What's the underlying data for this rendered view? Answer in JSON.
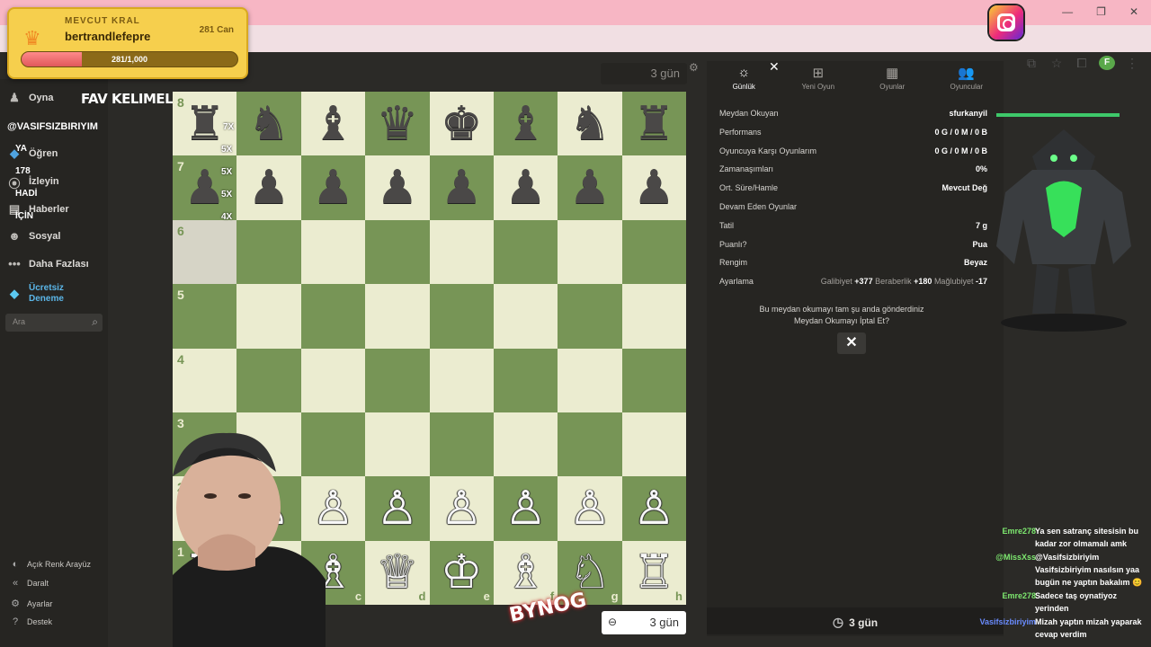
{
  "king": {
    "subtitle": "MEVCUT KRAL",
    "username": "bertrandlefepre",
    "coins": "281 Can",
    "progress_text": "281/1,000",
    "progress_fraction": 0.281
  },
  "sidebar": {
    "items": [
      {
        "label": "Oyna",
        "icon": "pawn-icon"
      },
      {
        "label": "Öğren",
        "icon": "learn-icon"
      },
      {
        "label": "İzleyin",
        "icon": "binoculars-icon"
      },
      {
        "label": "Haberler",
        "icon": "news-icon"
      },
      {
        "label": "Sosyal",
        "icon": "social-icon"
      },
      {
        "label": "Daha Fazlası",
        "icon": "more-icon"
      },
      {
        "label": "Ücretsiz Deneme",
        "icon": "diamond-icon"
      }
    ],
    "search_placeholder": "Ara",
    "bottom": [
      {
        "label": "Açık Renk Arayüz",
        "icon": "theme-icon"
      },
      {
        "label": "Daralt",
        "icon": "collapse-icon"
      },
      {
        "label": "Ayarlar",
        "icon": "gear-icon"
      },
      {
        "label": "Destek",
        "icon": "help-icon"
      }
    ],
    "overlay": {
      "fav": "FAV KELIMELER",
      "vasif": "@VASIFSIZBIRIYIM",
      "ya": "YA",
      "num": "178",
      "hadi": "HADİ",
      "icin": "İÇİN"
    }
  },
  "board": {
    "top_timer": "3 gün",
    "bottom_timer": "3 gün",
    "ranks": [
      "8",
      "7",
      "6",
      "5",
      "4",
      "3",
      "2",
      "1"
    ],
    "files": [
      "a",
      "b",
      "c",
      "d",
      "e",
      "f",
      "g",
      "h"
    ],
    "rows": [
      [
        "♜",
        "♞",
        "♝",
        "♛",
        "♚",
        "♝",
        "♞",
        "♜"
      ],
      [
        "♟",
        "♟",
        "♟",
        "♟",
        "♟",
        "♟",
        "♟",
        "♟"
      ],
      [
        "",
        "",
        "",
        "",
        "",
        "",
        "",
        ""
      ],
      [
        "",
        "",
        "",
        "",
        "",
        "",
        "",
        ""
      ],
      [
        "",
        "",
        "",
        "",
        "",
        "",
        "",
        ""
      ],
      [
        "",
        "",
        "",
        "",
        "",
        "",
        "",
        ""
      ],
      [
        "♙",
        "♙",
        "♙",
        "♙",
        "♙",
        "♙",
        "♙",
        "♙"
      ],
      [
        "♖",
        "♘",
        "♗",
        "♕",
        "♔",
        "♗",
        "♘",
        "♖"
      ]
    ],
    "multipliers": [
      "7X",
      "5X",
      "5X",
      "4X",
      "5X"
    ],
    "sticker": "BYNOG"
  },
  "panel": {
    "tabs": [
      {
        "label": "Günlük",
        "icon": "sun-icon",
        "active": true
      },
      {
        "label": "Yeni Oyun",
        "icon": "plus-icon",
        "active": false
      },
      {
        "label": "Oyunlar",
        "icon": "board-icon",
        "active": false
      },
      {
        "label": "Oyuncular",
        "icon": "players-icon",
        "active": false
      }
    ],
    "rows": [
      {
        "label": "Meydan Okuyan",
        "value": "sfurkanyil"
      },
      {
        "label": "Performans",
        "value": "0 G / 0 M / 0 B"
      },
      {
        "label": "Oyuncuya Karşı Oyunlarım",
        "value": "0 G / 0 M / 0 B"
      },
      {
        "label": "Zamanaşımları",
        "value": "0%"
      },
      {
        "label": "Ort. Süre/Hamle",
        "value": "Mevcut Değ"
      },
      {
        "label": "Devam Eden Oyunlar",
        "value": ""
      },
      {
        "label": "Tatil",
        "value": "7 g"
      },
      {
        "label": "Puanlı?",
        "value": "Pua"
      },
      {
        "label": "Rengim",
        "value": "Beyaz"
      }
    ],
    "rating": {
      "label": "Ayarlama",
      "win_label": "Galibiyet",
      "win": "+377",
      "draw_label": "Beraberlik",
      "draw": "+180",
      "loss_label": "Mağlubiyet",
      "loss": "-17"
    },
    "message_line1": "Bu meydan okumayı tam şu anda gönderdiniz",
    "message_line2": "Meydan Okumayı İptal Et?",
    "cancel": "✕",
    "timer": "3 gün"
  },
  "chat": [
    {
      "user": "Emre278",
      "text": "Ya sen satranç sitesisin bu kadar zor olmamalı amk",
      "color": "#7de86f"
    },
    {
      "user": "@MissXss",
      "text": "@Vasifsizbiriyim Vasifsizbiriyim nasılsın yaa bugün ne yaptın bakalım 😊",
      "color": "#7de86f"
    },
    {
      "user": "Emre278",
      "text": "Sadece taş oynatiyoz yerinden",
      "color": "#7de86f"
    },
    {
      "user": "Vasifsizbiriyim",
      "text": "Mizah yaptın mizah yaparak cevap verdim",
      "color": "#6a8cff"
    }
  ]
}
